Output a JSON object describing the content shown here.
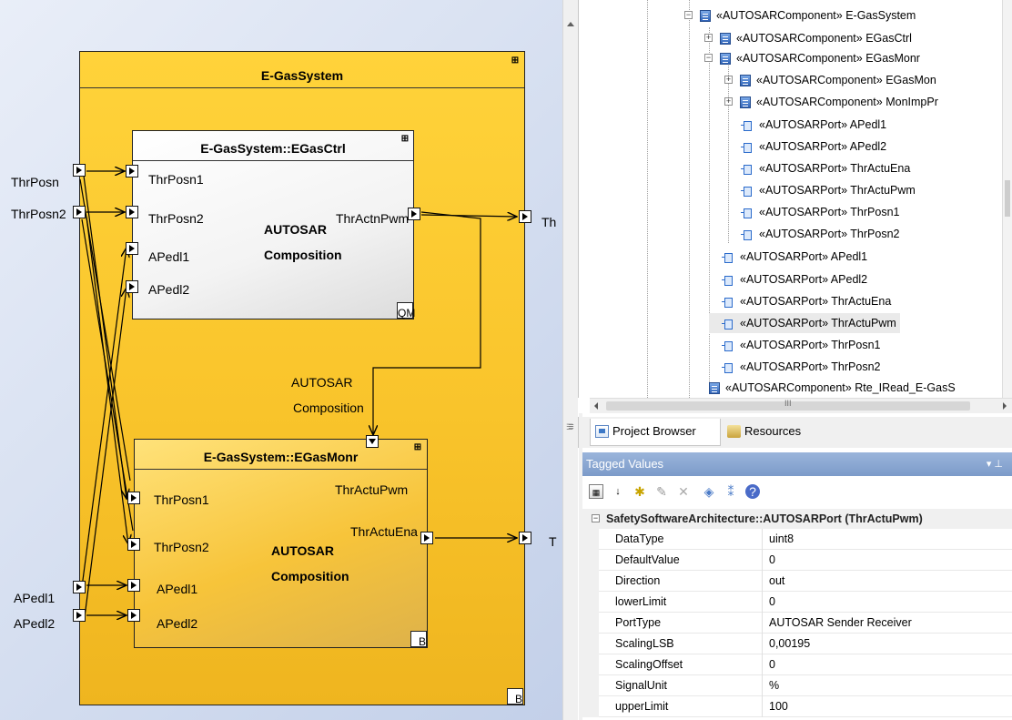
{
  "diagram": {
    "outer": {
      "title": "E-GasSystem",
      "corner_tag": "B"
    },
    "ctrl": {
      "title": "E-GasSystem::EGasCtrl",
      "kind_line1": "AUTOSAR",
      "kind_line2": "Composition",
      "corner_tag": "QM",
      "ports_in": [
        "ThrPosn1",
        "ThrPosn2",
        "APedl1",
        "APedl2"
      ],
      "port_out": "ThrActnPwm"
    },
    "monr": {
      "title": "E-GasSystem::EGasMonr",
      "kind_line1": "AUTOSAR",
      "kind_line2": "Composition",
      "corner_tag": "B",
      "ports_in": [
        "ThrPosn1",
        "ThrPosn2",
        "APedl1",
        "APedl2"
      ],
      "port_out_1": "ThrActuPwm",
      "port_out_2": "ThrActuEna"
    },
    "middle_label_1": "AUTOSAR",
    "middle_label_2": "Composition",
    "ext_ports_left": [
      "ThrPosn",
      "ThrPosn2",
      "APedl1",
      "APedl2"
    ],
    "ext_ports_right_1": "Th",
    "ext_ports_right_2": "T"
  },
  "tree": {
    "nodes": [
      {
        "label": "«AUTOSARComponent» E-GasSystem",
        "icon": "component-icon",
        "expander": "−"
      },
      {
        "label": "«AUTOSARComponent» EGasCtrl",
        "icon": "component-icon",
        "expander": "+"
      },
      {
        "label": "«AUTOSARComponent» EGasMonr",
        "icon": "component-icon",
        "expander": "−"
      },
      {
        "label": "«AUTOSARComponent» EGasMon",
        "icon": "component-icon",
        "expander": "+"
      },
      {
        "label": "«AUTOSARComponent» MonImpPr",
        "icon": "component-icon",
        "expander": "+"
      },
      {
        "label": "«AUTOSARPort» APedl1",
        "icon": "port-icon"
      },
      {
        "label": "«AUTOSARPort» APedl2",
        "icon": "port-icon"
      },
      {
        "label": "«AUTOSARPort» ThrActuEna",
        "icon": "port-icon"
      },
      {
        "label": "«AUTOSARPort» ThrActuPwm",
        "icon": "port-icon"
      },
      {
        "label": "«AUTOSARPort» ThrPosn1",
        "icon": "port-icon"
      },
      {
        "label": "«AUTOSARPort» ThrPosn2",
        "icon": "port-icon"
      },
      {
        "label": "«AUTOSARPort» APedl1",
        "icon": "port-icon"
      },
      {
        "label": "«AUTOSARPort» APedl2",
        "icon": "port-icon"
      },
      {
        "label": "«AUTOSARPort» ThrActuEna",
        "icon": "port-icon"
      },
      {
        "label": "«AUTOSARPort» ThrActuPwm",
        "icon": "port-icon",
        "selected": true
      },
      {
        "label": "«AUTOSARPort» ThrPosn1",
        "icon": "port-icon"
      },
      {
        "label": "«AUTOSARPort» ThrPosn2",
        "icon": "port-icon"
      },
      {
        "label": "«AUTOSARComponent» Rte_IRead_E-GasS",
        "icon": "component-icon"
      }
    ],
    "hscroll_dots": "III"
  },
  "tabs": [
    {
      "label": "Project Browser",
      "icon": "project-browser-icon",
      "active": true
    },
    {
      "label": "Resources",
      "icon": "resources-icon",
      "active": false
    }
  ],
  "tagged_values": {
    "header": "Tagged Values",
    "header_controls": "▾ ⊥",
    "group": "SafetySoftwareArchitecture::AUTOSARPort (ThrActuPwm)",
    "rows": [
      {
        "key": "DataType",
        "value": "uint8"
      },
      {
        "key": "DefaultValue",
        "value": "0"
      },
      {
        "key": "Direction",
        "value": "out"
      },
      {
        "key": "lowerLimit",
        "value": "0"
      },
      {
        "key": "PortType",
        "value": "AUTOSAR Sender Receiver"
      },
      {
        "key": "ScalingLSB",
        "value": "0,00195"
      },
      {
        "key": "ScalingOffset",
        "value": "0"
      },
      {
        "key": "SignalUnit",
        "value": "%"
      },
      {
        "key": "upperLimit",
        "value": "100"
      }
    ]
  },
  "colors": {
    "composition_fill": "#f9c42b",
    "panel_header": "#8aa8d4",
    "canvas_bg": "#d2dcef"
  }
}
